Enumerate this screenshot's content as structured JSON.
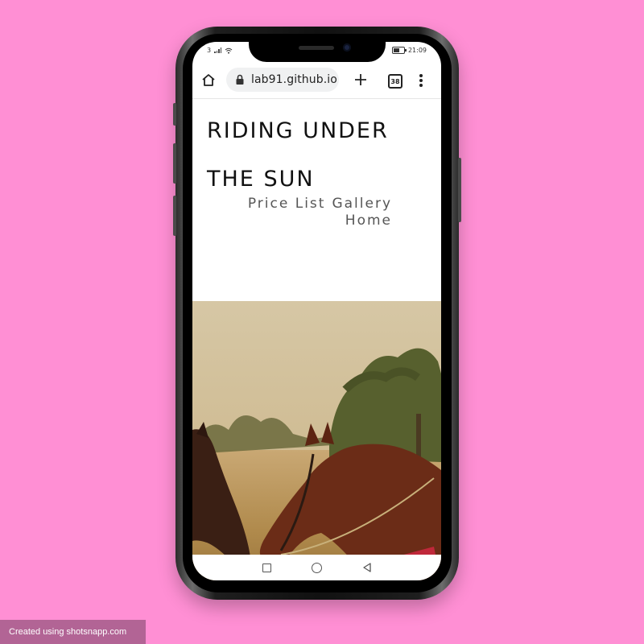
{
  "status_bar": {
    "network": "3",
    "time": "21:09"
  },
  "browser": {
    "url": "lab91.github.io",
    "tab_count": "38",
    "icons": [
      "home-icon",
      "lock-icon",
      "plus-icon",
      "tab-switcher-icon",
      "more-vertical-icon"
    ]
  },
  "site": {
    "title_line1": "RIDING UNDER",
    "title_line2": "THE SUN",
    "nav": {
      "price_list": "Price List",
      "gallery": "Gallery",
      "home": "Home"
    }
  },
  "android_nav": {
    "icons": [
      "recents-square-icon",
      "home-circle-icon",
      "back-triangle-icon"
    ]
  },
  "watermark": "Created using shotsnapp.com",
  "colors": {
    "background": "#ff8fd4",
    "watermark_bg": "#b26495"
  }
}
